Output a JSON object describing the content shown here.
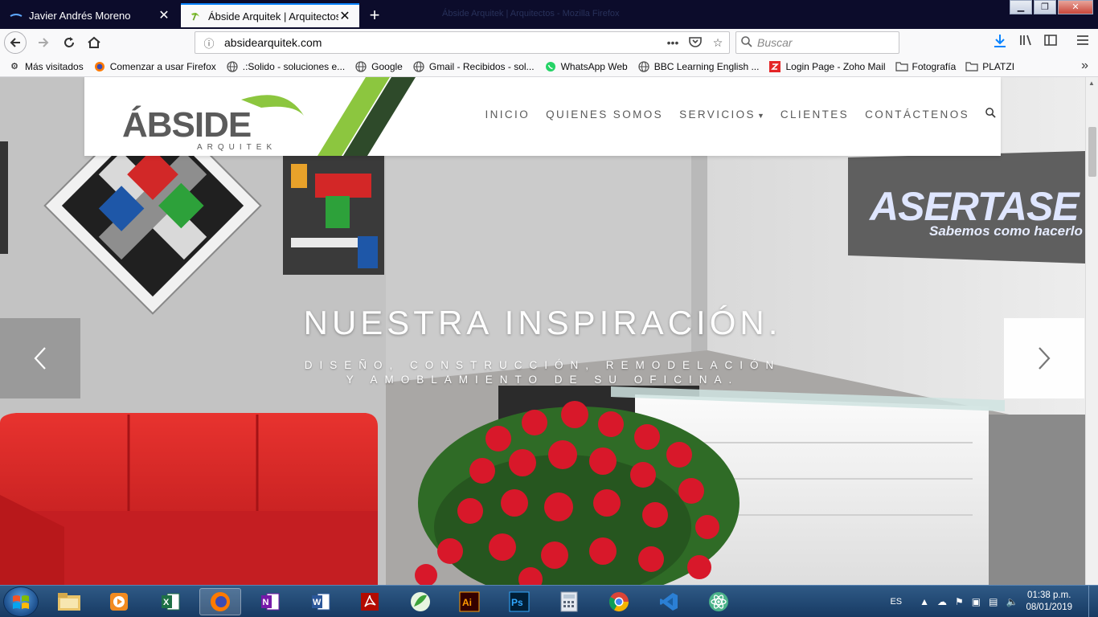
{
  "browser": {
    "window_title": "Ábside Arquitek | Arquitectos - Mozilla Firefox",
    "tabs": [
      {
        "title": "Javier Andrés Moreno",
        "active": false
      },
      {
        "title": "Ábside Arquitek | Arquitectos",
        "active": true
      }
    ],
    "url": "absidearquitek.com",
    "search_placeholder": "Buscar",
    "bookmarks": [
      {
        "label": "Más visitados",
        "icon": "gear-icon"
      },
      {
        "label": "Comenzar a usar Firefox",
        "icon": "firefox-icon"
      },
      {
        "label": ".:Solido - soluciones e...",
        "icon": "globe-icon"
      },
      {
        "label": "Google",
        "icon": "globe-icon"
      },
      {
        "label": "Gmail - Recibidos - sol...",
        "icon": "globe-icon"
      },
      {
        "label": "WhatsApp Web",
        "icon": "whatsapp-icon"
      },
      {
        "label": "BBC Learning English ...",
        "icon": "globe-icon"
      },
      {
        "label": "Login Page - Zoho Mail",
        "icon": "zoho-icon"
      },
      {
        "label": "Fotografía",
        "icon": "folder-icon"
      },
      {
        "label": "PLATZI",
        "icon": "folder-icon"
      }
    ]
  },
  "site": {
    "logo_main": "ÁBSIDE",
    "logo_sub": "ARQUITEK",
    "nav": [
      {
        "label": "INICIO"
      },
      {
        "label": "QUIENES SOMOS"
      },
      {
        "label": "SERVICIOS",
        "dropdown": true
      },
      {
        "label": "CLIENTES"
      },
      {
        "label": "CONTÁCTENOS"
      }
    ],
    "hero": {
      "title": "NUESTRA INSPIRACIÓN.",
      "subtitle_line1": "DISEÑO, CONSTRUCCIÓN, REMODELACIÓN",
      "subtitle_line2": "Y AMOBLAMIENTO DE SU OFICINA.",
      "wall_sign": "ASERTASE",
      "wall_slogan": "Sabemos como hacerlo"
    }
  },
  "taskbar": {
    "apps": [
      "file-explorer",
      "media-player",
      "excel",
      "firefox",
      "onenote",
      "word",
      "acrobat",
      "app-green",
      "illustrator",
      "photoshop",
      "calculator",
      "chrome",
      "visual-studio",
      "atom"
    ],
    "language": "ES",
    "time": "01:38 p.m.",
    "date": "08/01/2019"
  },
  "colors": {
    "brand_green": "#8cc63f",
    "brand_gray": "#5b5b5b",
    "sofa_red": "#d8262a",
    "taskbar_blue": "#1f4a7a"
  }
}
